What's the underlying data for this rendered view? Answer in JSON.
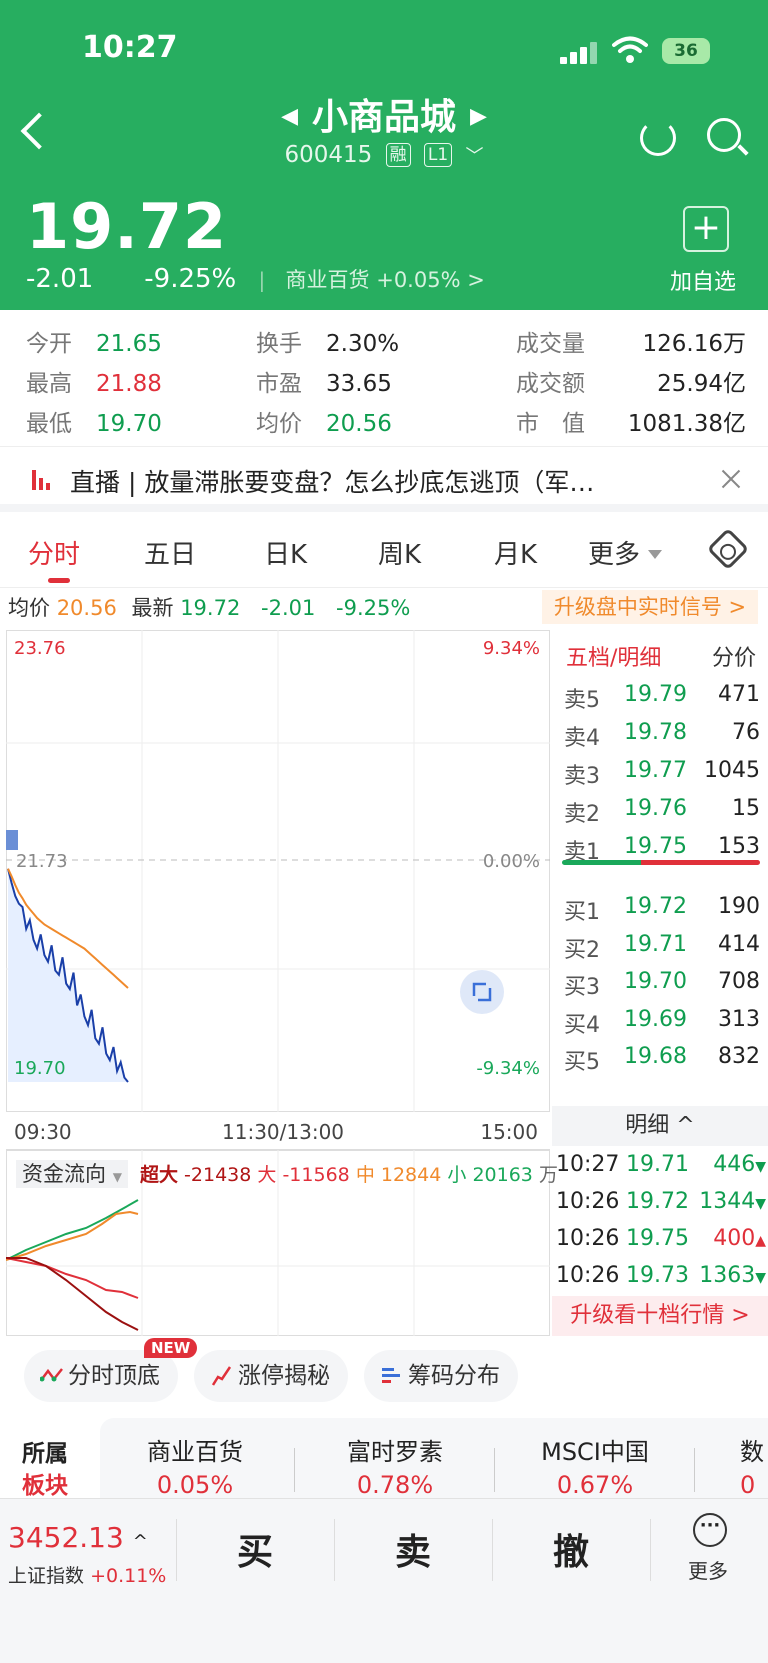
{
  "status": {
    "time": "10:27",
    "battery": "36"
  },
  "stock": {
    "name": "小商品城",
    "code": "600415",
    "badge_margin": "融",
    "badge_level": "L1",
    "price": "19.72",
    "change": "-2.01",
    "change_pct": "-9.25%",
    "sector_name": "商业百货",
    "sector_change": "+0.05%",
    "add_watch": "加自选"
  },
  "stats": [
    {
      "k": "今开",
      "v": "21.65",
      "color": "green"
    },
    {
      "k": "换手",
      "v": "2.30%",
      "color": "black"
    },
    {
      "k": "成交量",
      "v": "126.16万",
      "color": "black"
    },
    {
      "k": "最高",
      "v": "21.88",
      "color": "red"
    },
    {
      "k": "市盈",
      "v": "33.65",
      "color": "black"
    },
    {
      "k": "成交额",
      "v": "25.94亿",
      "color": "black"
    },
    {
      "k": "最低",
      "v": "19.70",
      "color": "green"
    },
    {
      "k": "均价",
      "v": "20.56",
      "color": "green"
    },
    {
      "k": "市　值",
      "v": "1081.38亿",
      "color": "black"
    }
  ],
  "live": {
    "prefix": "直播",
    "text": "直播 | 放量滞胀要变盘？怎么抄底怎逃顶（军…"
  },
  "tabs": [
    {
      "label": "分时",
      "active": true
    },
    {
      "label": "五日",
      "active": false
    },
    {
      "label": "日K",
      "active": false
    },
    {
      "label": "周K",
      "active": false
    },
    {
      "label": "月K",
      "active": false
    },
    {
      "label": "更多",
      "active": false
    }
  ],
  "info": {
    "avg_label": "均价",
    "avg_value": "20.56",
    "last_label": "最新",
    "last_value": "19.72",
    "change": "-2.01",
    "change_pct": "-9.25%",
    "upgrade": "升级盘中实时信号 >"
  },
  "chart_data": {
    "type": "line",
    "x_ticks": [
      "09:30",
      "11:30/13:00",
      "15:00"
    ],
    "ylim": [
      19.7,
      23.76
    ],
    "y_top_label": "23.76",
    "y_mid_label": "21.73",
    "y_bottom_label": "19.70",
    "pct_top_label": "9.34%",
    "pct_mid_label": "0.00%",
    "pct_bottom_label": "-9.34%",
    "prev_close": 21.73,
    "series": [
      {
        "values": [
          21.65,
          21.52,
          21.4,
          21.33,
          21.3,
          21.1,
          21.18,
          21.0,
          20.92,
          21.05,
          20.86,
          20.8,
          20.95,
          20.72,
          20.68,
          20.84,
          20.6,
          20.55,
          20.7,
          20.4,
          20.5,
          20.3,
          20.22,
          20.36,
          20.1,
          20.05,
          20.2,
          19.96,
          19.9,
          20.02,
          19.8,
          19.88,
          19.74,
          19.7
        ],
        "color": "#1a3fa8"
      },
      {
        "values": [
          21.65,
          21.58,
          21.5,
          21.43,
          21.38,
          21.32,
          21.28,
          21.24,
          21.2,
          21.17,
          21.14,
          21.12,
          21.1,
          21.08,
          21.06,
          21.04,
          21.02,
          21.0,
          20.98,
          20.96,
          20.94,
          20.92,
          20.89,
          20.86,
          20.83,
          20.8,
          20.77,
          20.74,
          20.71,
          20.68,
          20.65,
          20.62,
          20.59,
          20.56
        ],
        "color": "#f08a2c"
      }
    ]
  },
  "flow": {
    "label": "资金流向",
    "super_label": "超大",
    "super_value": "-21438",
    "large_label": "大",
    "large_value": "-11568",
    "mid_label": "中",
    "mid_value": "12844",
    "small_label": "小",
    "small_value": "20163",
    "unit": "万"
  },
  "book": {
    "title": "五档/明细",
    "mode": "分价",
    "asks": [
      {
        "label": "卖5",
        "price": "19.79",
        "vol": "471"
      },
      {
        "label": "卖4",
        "price": "19.78",
        "vol": "76"
      },
      {
        "label": "卖3",
        "price": "19.77",
        "vol": "1045"
      },
      {
        "label": "卖2",
        "price": "19.76",
        "vol": "15"
      },
      {
        "label": "卖1",
        "price": "19.75",
        "vol": "153"
      }
    ],
    "bids": [
      {
        "label": "买1",
        "price": "19.72",
        "vol": "190"
      },
      {
        "label": "买2",
        "price": "19.71",
        "vol": "414"
      },
      {
        "label": "买3",
        "price": "19.70",
        "vol": "708"
      },
      {
        "label": "买4",
        "price": "19.69",
        "vol": "313"
      },
      {
        "label": "买5",
        "price": "19.68",
        "vol": "832"
      }
    ],
    "detail_label": "明细 ^",
    "ticks": [
      {
        "time": "10:27",
        "price": "19.71",
        "vol": "446",
        "dir": "down"
      },
      {
        "time": "10:26",
        "price": "19.72",
        "vol": "1344",
        "dir": "down"
      },
      {
        "time": "10:26",
        "price": "19.75",
        "vol": "400",
        "dir": "up"
      },
      {
        "time": "10:26",
        "price": "19.73",
        "vol": "1363",
        "dir": "down"
      }
    ],
    "upgrade10": "升级看十档行情 >"
  },
  "tools": [
    {
      "label": "分时顶底",
      "badge": "NEW"
    },
    {
      "label": "涨停揭秘"
    },
    {
      "label": "筹码分布"
    }
  ],
  "sectors": {
    "label_1": "所属",
    "label_2": "板块",
    "items": [
      {
        "name": "商业百货",
        "pct": "0.05%"
      },
      {
        "name": "富时罗素",
        "pct": "0.78%"
      },
      {
        "name": "MSCI中国",
        "pct": "0.67%"
      },
      {
        "name": "数",
        "pct": "0"
      }
    ]
  },
  "bottom": {
    "index_value": "3452.13",
    "index_name": "上证指数",
    "index_change": "+0.11%",
    "buy": "买",
    "sell": "卖",
    "cancel": "撤",
    "more": "更多"
  }
}
